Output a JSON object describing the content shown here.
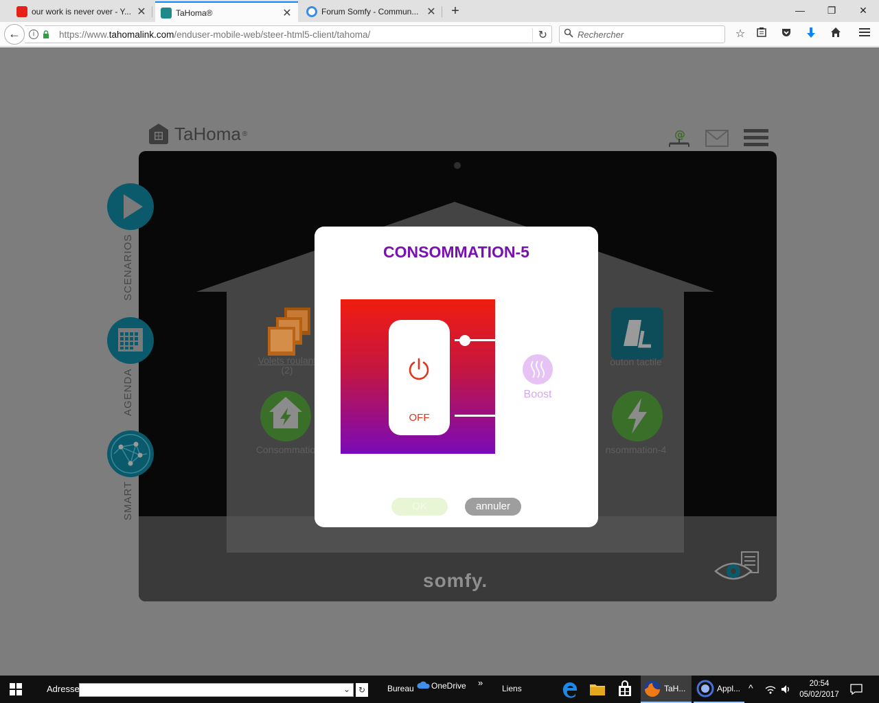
{
  "browser": {
    "tabs": [
      {
        "title": "our work is never over - Y...",
        "favicon_color": "#e62117",
        "active": false
      },
      {
        "title": "TaHoma®",
        "favicon_color": "#1f8a8a",
        "active": true
      },
      {
        "title": "Forum Somfy - Commun...",
        "favicon_color": "#3b8de0",
        "active": false
      }
    ],
    "url_prefix": "https://www.",
    "url_domain": "tahomalink.com",
    "url_path": "/enduser-mobile-web/steer-html5-client/tahoma/",
    "search_placeholder": "Rechercher"
  },
  "app": {
    "logo_text": "TaHoma",
    "logo_mark": "®",
    "sidebar": {
      "scenarios_label": "SCENARIOS",
      "agenda_label": "AGENDA",
      "smart_label": "SMART"
    },
    "devices": {
      "volets_label": "Volets roulant",
      "volets_count": "(2)",
      "consommation_left_label": "Consommatio",
      "bouton_label": "outon tactile",
      "consommation4_label": "nsommation-4"
    },
    "brand": "somfy."
  },
  "dialog": {
    "title": "CONSOMMATION-5",
    "state_label": "OFF",
    "boost_label": "Boost",
    "ok_label": "OK",
    "cancel_label": "annuler"
  },
  "taskbar": {
    "address_label": "Adresse",
    "bureau_label": "Bureau",
    "onedrive_label": "OneDrive",
    "chevron": "»",
    "liens_label": "Liens",
    "firefox_label": "TaH...",
    "app2_label": "Appl...",
    "time": "20:54",
    "date": "05/02/2017"
  },
  "colors": {
    "accent_tab": "#0a84ff",
    "dialog_title": "#7a0fb3",
    "teal": "#0b5a6b",
    "green": "#3a8a2e",
    "orange": "#c86a16"
  }
}
